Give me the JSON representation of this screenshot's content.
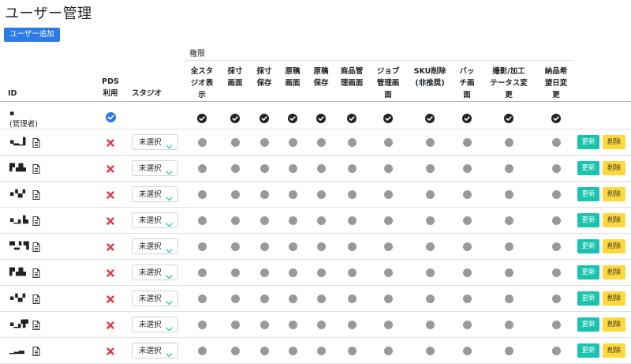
{
  "page": {
    "title": "ユーザー管理",
    "add_user_label": "ユーザー追加"
  },
  "table": {
    "group_label": "権限",
    "headers": {
      "id": "ID",
      "pds": [
        "PDS",
        "利用"
      ],
      "studio": "スタジオ",
      "permissions": [
        [
          "全スタ",
          "ジオ表",
          "示"
        ],
        [
          "採寸",
          "画面"
        ],
        [
          "採寸",
          "保存"
        ],
        [
          "原稿",
          "画面"
        ],
        [
          "原稿",
          "保存"
        ],
        [
          "商品管",
          "理画面"
        ],
        [
          "ジョブ",
          "管理画",
          "面"
        ],
        [
          "SKU削除",
          "(非推奨)"
        ],
        [
          "バッ",
          "チ画",
          "面"
        ],
        [
          "撮影/加工",
          "テータス変",
          "更"
        ],
        [
          "納品希",
          "望日変",
          "更"
        ]
      ]
    },
    "admin_row": {
      "id_line1": "▪",
      "id_line2": "(管理者)"
    },
    "rows": [
      {
        "id_mark": "▪▂▁▌",
        "studio_value": "未選択",
        "update_label": "更新",
        "delete_label": "削除"
      },
      {
        "id_mark": "▛ ▟▙",
        "studio_value": "未選択",
        "update_label": "更新",
        "delete_label": "削除"
      },
      {
        "id_mark": "▪ ▚▞",
        "studio_value": "未選択",
        "update_label": "更新",
        "delete_label": "削除"
      },
      {
        "id_mark": "▪▁▖▙",
        "studio_value": "未選択",
        "update_label": "更新",
        "delete_label": "削除"
      },
      {
        "id_mark": "▀▂▘▜",
        "studio_value": "未選択",
        "update_label": "更新",
        "delete_label": "削除"
      },
      {
        "id_mark": "▛ ▟▙",
        "studio_value": "未選択",
        "update_label": "更新",
        "delete_label": "削除"
      },
      {
        "id_mark": "▪ ▚▞",
        "studio_value": "未選択",
        "update_label": "更新",
        "delete_label": "削除"
      },
      {
        "id_mark": "▪▁▞▛",
        "studio_value": "未選択",
        "update_label": "更新",
        "delete_label": "削除"
      },
      {
        "id_mark": "▁▂▃",
        "studio_value": "未選択",
        "update_label": "更新",
        "delete_label": "削除"
      }
    ]
  },
  "colors": {
    "primary": "#2f7be6",
    "update": "#19c3ad",
    "delete": "#ffd93b",
    "disabled_x": "#e8374a",
    "permission_off": "#999999",
    "permission_on": "#222222"
  },
  "icons": {
    "pds_enabled": "check-circle-blue-icon",
    "pds_disabled": "x-red-icon",
    "permission_on": "check-circle-dark-icon",
    "permission_off": "gray-dot-icon",
    "user_detail": "document-icon",
    "dropdown": "chevron-down-icon"
  }
}
